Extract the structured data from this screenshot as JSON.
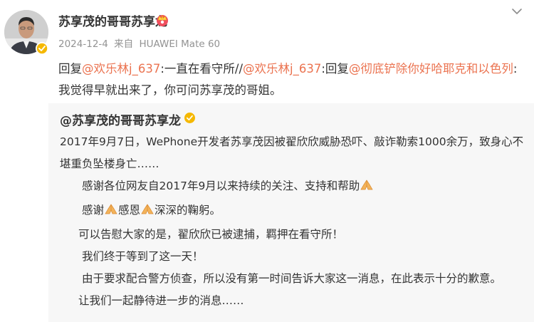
{
  "post": {
    "author": "苏享茂的哥哥苏享龙",
    "date": "2024-12-4",
    "source_prefix": "来自",
    "device": "HUAWEI Mate 60",
    "reply": {
      "prefix1": "回复",
      "mention1": "@欢乐林j_637",
      "text1": ":一直在看守所//",
      "mention2": "@欢乐林j_637",
      "text2": ":回复",
      "mention3": "@彻底铲除你好哈耶克和以色列",
      "text3": ":我觉得早就出来了，你可问苏享茂的哥姐。"
    }
  },
  "quoted": {
    "author": "@苏享茂的哥哥苏享龙",
    "lines": {
      "l1": "2017年9月7日，WePhone开发者苏享茂因被翟欣欣威胁恐吓、敲诈勒索1000余万，致身心不堪重负坠楼身亡……",
      "l2": "感谢各位网友自2017年9月以来持续的关注、支持和帮助",
      "l3a": "感谢",
      "l3b": "感恩",
      "l3c": "深深的鞠躬。",
      "l4": "可以告慰大家的是，翟欣欣已被逮捕，羁押在看守所！",
      "l5": "我们终于等到了这一天！",
      "l6": "由于要求配合警方侦查，所以没有第一时间告诉大家这一消息，在此表示十分的歉意。",
      "l7": "让我们一起静待进一步的消息……"
    }
  },
  "colors": {
    "link": "#eb7350",
    "meta": "#939393",
    "quote_bg": "#f7f7f7",
    "verified": "#f5b800"
  },
  "icons": {
    "verified": "verified-badge-icon",
    "crown": "crown-icon",
    "hands": "praying-hands-icon",
    "menu": "chevron-down-icon"
  }
}
